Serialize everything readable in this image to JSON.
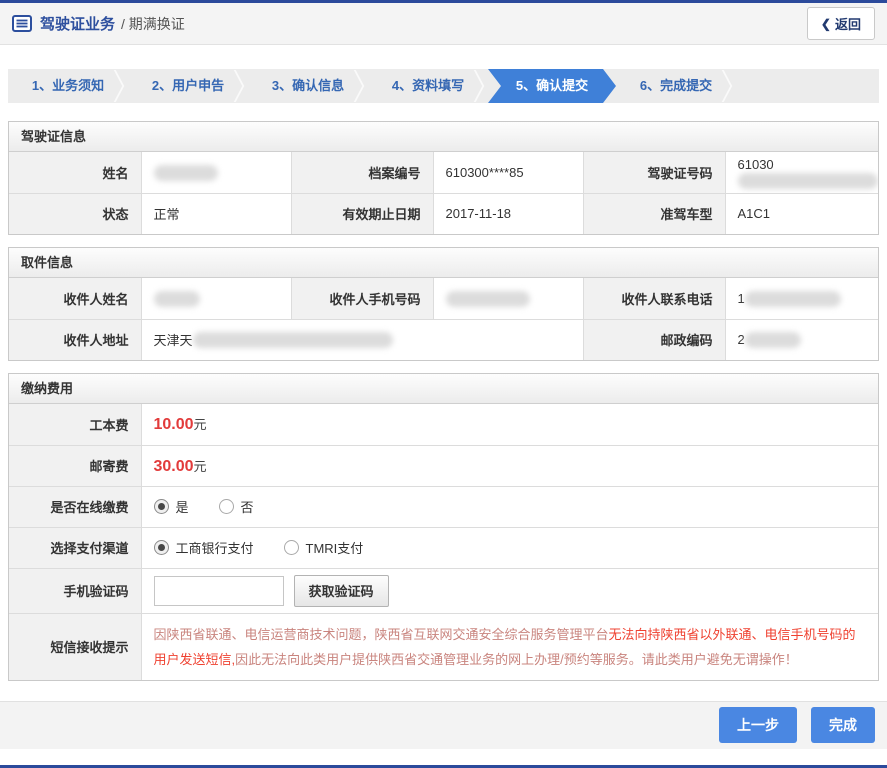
{
  "colors": {
    "top_bottom_bar": "#2b4a9b",
    "step_active": "#3f80d8",
    "primary_button": "#4a87e2",
    "fee_red": "#e23b3b",
    "notice_soft_red": "#c9847e",
    "notice_strong_red": "#ef4130",
    "title_blue": "#2d4f9e"
  },
  "header": {
    "title_primary": "驾驶证业务",
    "title_secondary": "/ 期满换证",
    "back_chevron": "❮",
    "back_label": "返回",
    "icon": "license-list-icon"
  },
  "steps": {
    "items": [
      {
        "label": "1、业务须知",
        "active": false
      },
      {
        "label": "2、用户申告",
        "active": false
      },
      {
        "label": "3、确认信息",
        "active": false
      },
      {
        "label": "4、资料填写",
        "active": false
      },
      {
        "label": "5、确认提交",
        "active": true
      },
      {
        "label": "6、完成提交",
        "active": false
      }
    ]
  },
  "license": {
    "title": "驾驶证信息",
    "name_label": "姓名",
    "name_value_redacted": true,
    "file_no_label": "档案编号",
    "file_no_value": "610300****85",
    "license_no_label": "驾驶证号码",
    "license_no_prefix": "61030",
    "license_no_redacted": true,
    "status_label": "状态",
    "status_value": "正常",
    "expiry_label": "有效期止日期",
    "expiry_value": "2017-11-18",
    "class_label": "准驾车型",
    "class_value": "A1C1"
  },
  "pickup": {
    "title": "取件信息",
    "recipient_name_label": "收件人姓名",
    "recipient_name_redacted": true,
    "mobile_label": "收件人手机号码",
    "mobile_redacted": true,
    "contact_phone_label": "收件人联系电话",
    "contact_phone_prefix": "1",
    "contact_phone_redacted": true,
    "address_label": "收件人地址",
    "address_prefix": "天津天",
    "address_redacted": true,
    "postcode_label": "邮政编码",
    "postcode_prefix": "2",
    "postcode_redacted": true
  },
  "fees": {
    "title": "缴纳费用",
    "production_fee_label": "工本费",
    "production_fee_amount": "10.00",
    "production_fee_unit": "元",
    "mailing_fee_label": "邮寄费",
    "mailing_fee_amount": "30.00",
    "mailing_fee_unit": "元",
    "online_pay_label": "是否在线缴费",
    "online_pay_yes": "是",
    "online_pay_yes_checked": true,
    "online_pay_no": "否",
    "online_pay_no_checked": false,
    "channel_label": "选择支付渠道",
    "channel_icbc": "工商银行支付",
    "channel_icbc_checked": true,
    "channel_tmri": "TMRI支付",
    "channel_tmri_checked": false,
    "sms_code_label": "手机验证码",
    "sms_code_value": "",
    "get_code_button": "获取验证码",
    "sms_notice_label": "短信接收提示",
    "sms_notice_part1": "因陕西省联通、电信运营商技术问题，陕西省互联网交通安全综合服务管理平台",
    "sms_notice_part2": "无法向持陕西省以外联通、电信手机号码的用户发送短信,",
    "sms_notice_part3": "因此无法向此类用户提供陕西省交通管理业务的网上办理/预约等服务。请此类用户避免无谓操作！"
  },
  "footer": {
    "prev_button": "上一步",
    "finish_button": "完成"
  }
}
